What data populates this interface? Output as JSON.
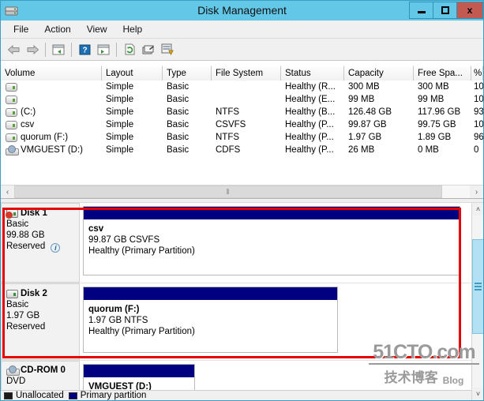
{
  "window": {
    "title": "Disk Management",
    "icon": "disk-management-icon",
    "buttons": {
      "minimize": "minimize-icon",
      "maximize": "maximize-icon",
      "close": "x"
    }
  },
  "menu": {
    "items": [
      "File",
      "Action",
      "View",
      "Help"
    ]
  },
  "toolbar": {
    "items": [
      "back-arrow-icon",
      "forward-arrow-icon",
      "separator",
      "show-hide-console-tree-icon",
      "separator",
      "help-icon",
      "show-hide-action-pane-icon",
      "separator",
      "refresh-icon",
      "properties-icon",
      "rescan-disks-icon"
    ]
  },
  "volume_list": {
    "columns": [
      "Volume",
      "Layout",
      "Type",
      "File System",
      "Status",
      "Capacity",
      "Free Spa...",
      "%"
    ],
    "rows": [
      {
        "volume": "",
        "icon": "drive-icon",
        "layout": "Simple",
        "type": "Basic",
        "fs": "",
        "status": "Healthy (R...",
        "capacity": "300 MB",
        "free": "300 MB",
        "pct": "10"
      },
      {
        "volume": "",
        "icon": "drive-icon",
        "layout": "Simple",
        "type": "Basic",
        "fs": "",
        "status": "Healthy (E...",
        "capacity": "99 MB",
        "free": "99 MB",
        "pct": "10"
      },
      {
        "volume": "(C:)",
        "icon": "drive-icon",
        "layout": "Simple",
        "type": "Basic",
        "fs": "NTFS",
        "status": "Healthy (B...",
        "capacity": "126.48 GB",
        "free": "117.96 GB",
        "pct": "93"
      },
      {
        "volume": "csv",
        "icon": "drive-icon",
        "layout": "Simple",
        "type": "Basic",
        "fs": "CSVFS",
        "status": "Healthy (P...",
        "capacity": "99.87 GB",
        "free": "99.75 GB",
        "pct": "10"
      },
      {
        "volume": "quorum (F:)",
        "icon": "drive-icon",
        "layout": "Simple",
        "type": "Basic",
        "fs": "NTFS",
        "status": "Healthy (P...",
        "capacity": "1.97 GB",
        "free": "1.89 GB",
        "pct": "96"
      },
      {
        "volume": "VMGUEST (D:)",
        "icon": "cdrom-icon",
        "layout": "Simple",
        "type": "Basic",
        "fs": "CDFS",
        "status": "Healthy (P...",
        "capacity": "26 MB",
        "free": "0 MB",
        "pct": "0"
      }
    ]
  },
  "graphical_view": {
    "disks": [
      {
        "name": "Disk 1",
        "icon": "disk-error-icon",
        "type": "Basic",
        "size": "99.88 GB",
        "state": "Reserved",
        "info_badge": "i",
        "partition": {
          "name": "csv",
          "size_fs": "99.87 GB CSVFS",
          "status": "Healthy (Primary Partition)"
        }
      },
      {
        "name": "Disk 2",
        "icon": "disk-icon",
        "type": "Basic",
        "size": "1.97 GB",
        "state": "Reserved",
        "info_badge": "",
        "partition": {
          "name": "quorum  (F:)",
          "size_fs": "1.97 GB NTFS",
          "status": "Healthy (Primary Partition)"
        }
      },
      {
        "name": "CD-ROM 0",
        "icon": "cdrom-icon",
        "type": "DVD",
        "size": "",
        "state": "",
        "info_badge": "",
        "partition": {
          "name": "VMGUEST  (D:)",
          "size_fs": "",
          "status": ""
        }
      }
    ]
  },
  "legend": {
    "items": [
      {
        "label": "Unallocated",
        "color": "#1a1a1a"
      },
      {
        "label": "Primary partition",
        "color": "#000080"
      }
    ]
  },
  "scrollbars": {
    "h_left": "‹",
    "h_right": "›",
    "h_grip": "⦀",
    "v_up": "˄",
    "v_down": "˅"
  },
  "annotation": {
    "highlight_color": "#e60000"
  },
  "watermark": {
    "main": "51CTO.com",
    "cn": "技术博客",
    "blog": "Blog"
  },
  "colors": {
    "titlebar": "#63c8e8",
    "close": "#c35a52",
    "partition_bar": "#000080",
    "scroll_thumb": "#b3e0f2"
  }
}
